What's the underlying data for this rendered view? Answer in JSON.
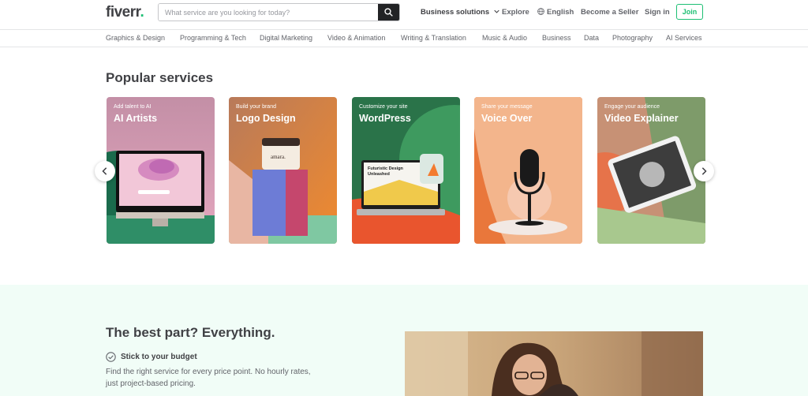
{
  "header": {
    "logo_text": "fiverr",
    "logo_dot": ".",
    "search_placeholder": "What service are you looking for today?",
    "nav": {
      "business_solutions": "Business solutions",
      "explore": "Explore",
      "language": "English",
      "become_seller": "Become a Seller",
      "sign_in": "Sign in",
      "join": "Join"
    }
  },
  "categories": [
    "Graphics & Design",
    "Programming & Tech",
    "Digital Marketing",
    "Video & Animation",
    "Writing & Translation",
    "Music & Audio",
    "Business",
    "Data",
    "Photography",
    "AI Services"
  ],
  "popular": {
    "title": "Popular services",
    "cards": [
      {
        "subtitle": "Add talent to AI",
        "title": "AI Artists",
        "color": "#1a6b4c"
      },
      {
        "subtitle": "Build your brand",
        "title": "Logo Design",
        "color": "#e08a3a"
      },
      {
        "subtitle": "Customize your site",
        "title": "WordPress",
        "color": "#2f7a4a"
      },
      {
        "subtitle": "Share your message",
        "title": "Voice Over",
        "color": "#e8743a"
      },
      {
        "subtitle": "Engage your audience",
        "title": "Video Explainer",
        "color": "#8aa56a"
      }
    ],
    "laptop_text": "Futuristic Design Unleashed",
    "jar_label": "amara."
  },
  "best": {
    "title": "The best part? Everything.",
    "feature_title": "Stick to your budget",
    "feature_desc": "Find the right service for every price point. No hourly rates, just project-based pricing."
  },
  "colors": {
    "brand_green": "#1dbf73",
    "text_dark": "#404145",
    "section_bg": "#f1fdf7"
  },
  "icons": [
    "search-icon",
    "chevron-down-icon",
    "globe-icon",
    "chevron-left-icon",
    "chevron-right-icon",
    "check-circle-icon"
  ]
}
